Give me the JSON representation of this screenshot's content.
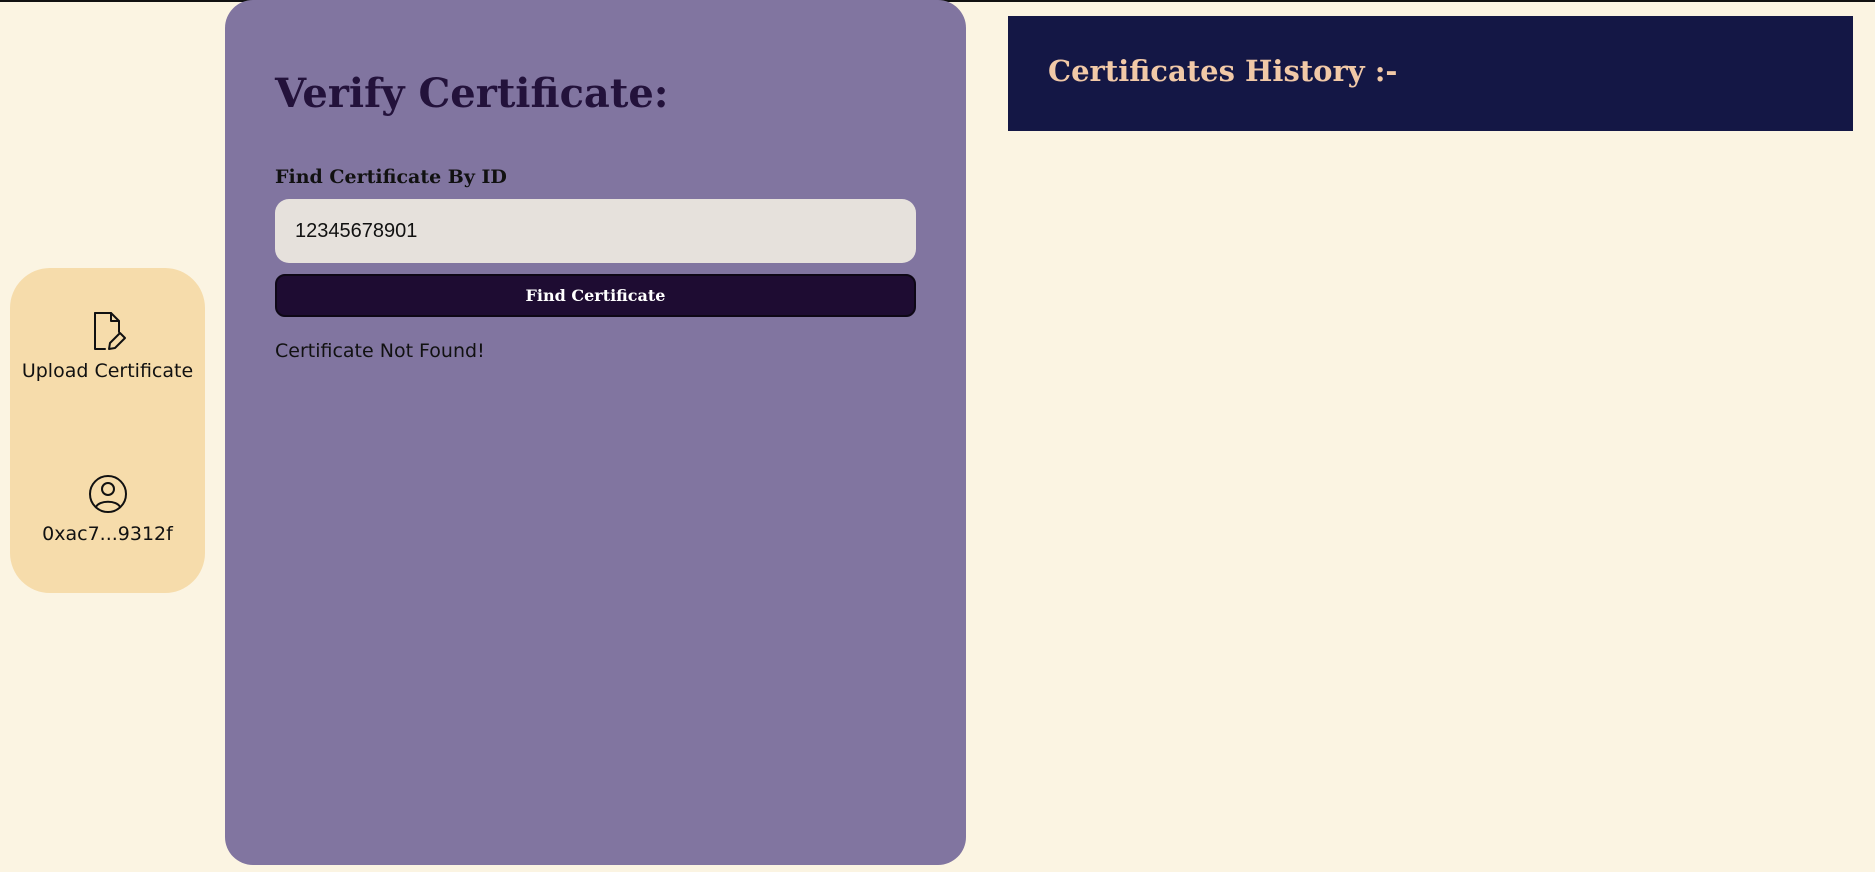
{
  "sidebar": {
    "items": [
      {
        "label": "Upload Certificate",
        "icon": "file-edit-icon"
      },
      {
        "label": "0xac7...9312f",
        "icon": "user-circle-icon"
      }
    ]
  },
  "verify": {
    "title": "Verify Certificate:",
    "find_label": "Find Certificate By ID",
    "input_value": "12345678901",
    "button_label": "Find Certificate",
    "status": "Certificate Not Found!"
  },
  "history": {
    "title": "Certificates History :-"
  },
  "colors": {
    "background": "#fbf4e2",
    "sidebar": "#f6dcab",
    "panel": "#8175a0",
    "button": "#1e0c32",
    "history_header": "#141745",
    "history_title": "#f1c9a7"
  }
}
